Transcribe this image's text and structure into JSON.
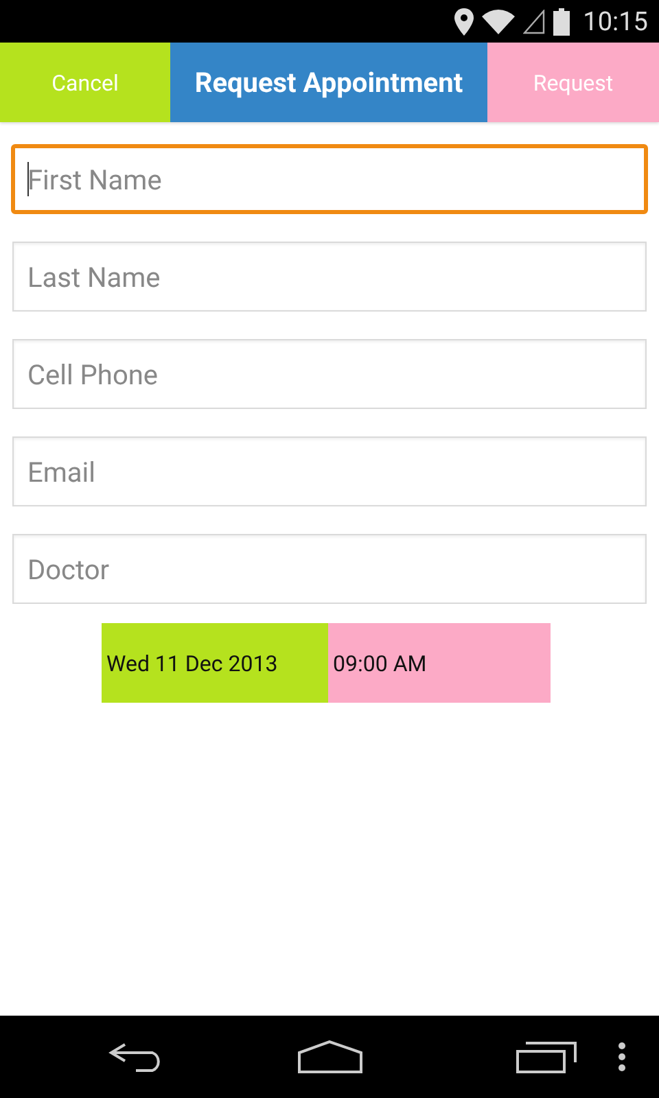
{
  "status_bar": {
    "time": "10:15"
  },
  "action_bar": {
    "cancel": "Cancel",
    "title": "Request Appointment",
    "request": "Request"
  },
  "fields": [
    {
      "placeholder": "First Name",
      "focused": true
    },
    {
      "placeholder": "Last Name",
      "focused": false
    },
    {
      "placeholder": "Cell Phone",
      "focused": false
    },
    {
      "placeholder": "Email",
      "focused": false
    },
    {
      "placeholder": "Doctor",
      "focused": false
    }
  ],
  "date": "Wed 11 Dec 2013",
  "time": "09:00 AM"
}
